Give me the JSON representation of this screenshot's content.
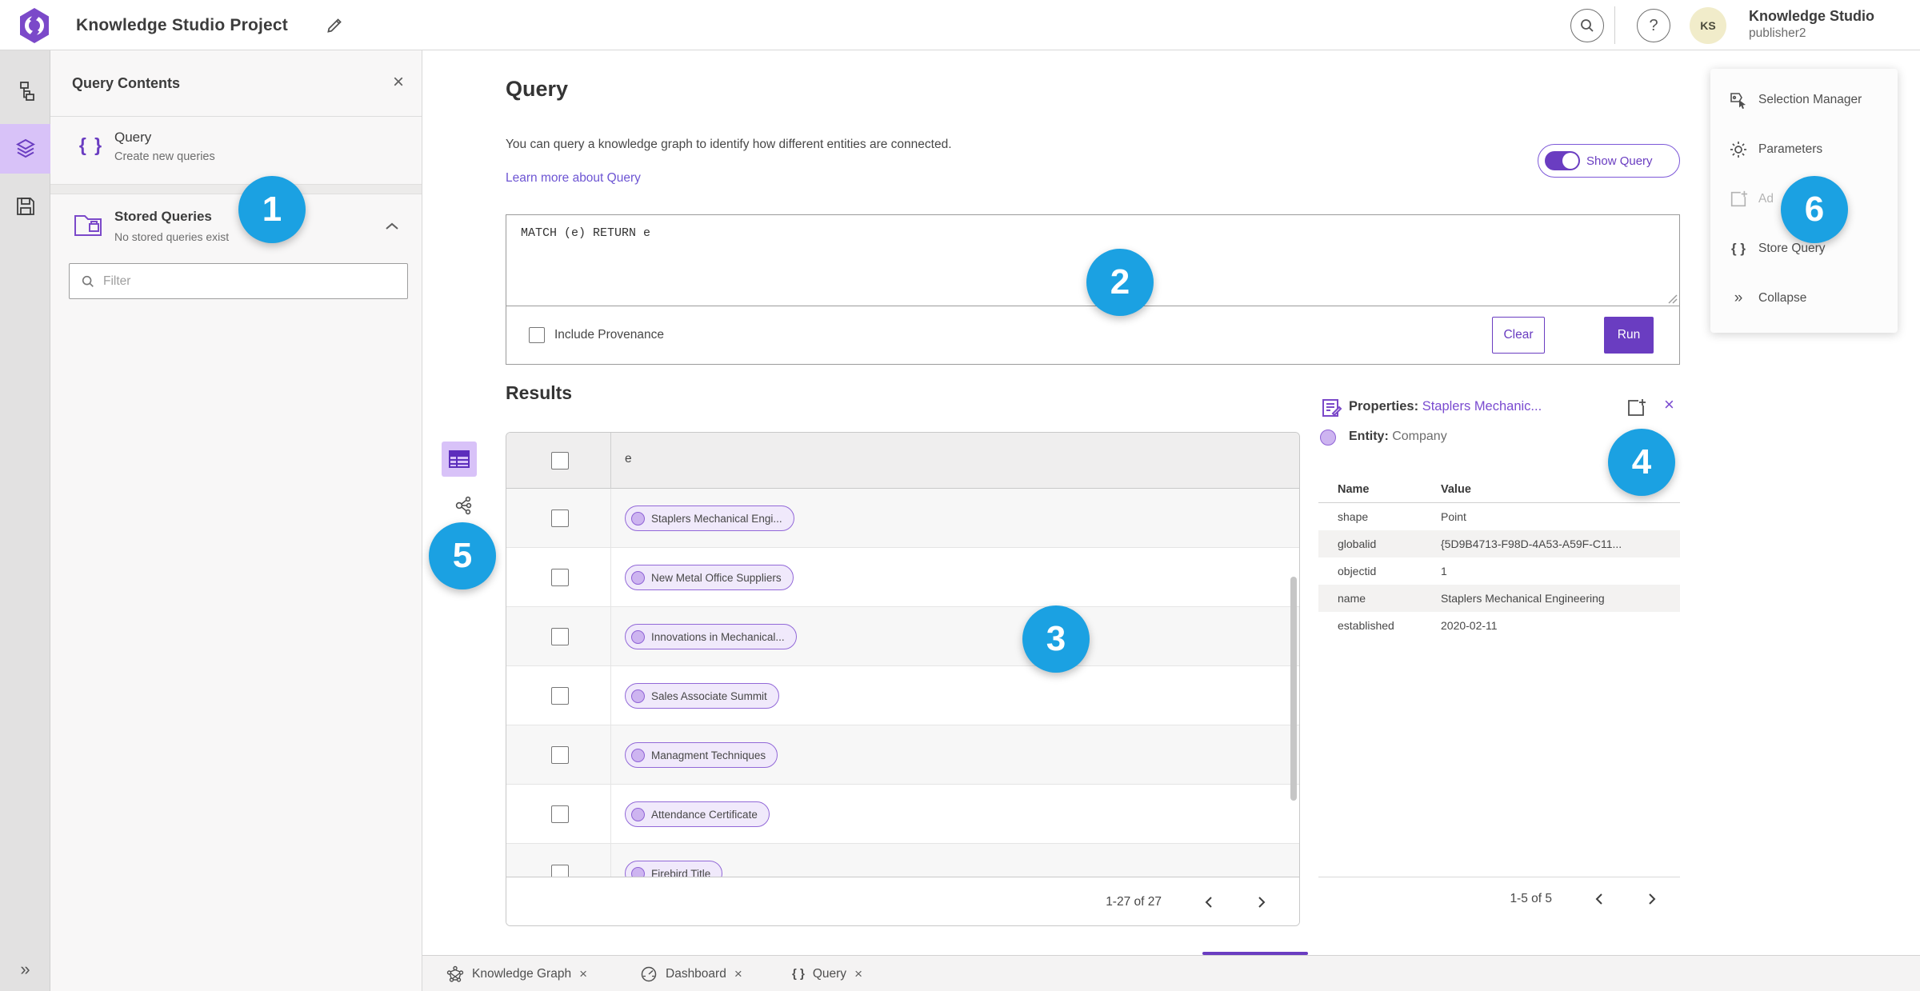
{
  "colors": {
    "accent": "#6a3dc1",
    "badge": "#1ba1e2",
    "chip_bg": "#f0e9fb",
    "chip_border": "#9268d8",
    "link": "#6d55d3"
  },
  "icons": {
    "close": "×",
    "help": "?",
    "braces": "{ }",
    "collapse": "»",
    "expand": "»"
  },
  "topbar": {
    "title": "Knowledge Studio Project",
    "avatar_initials": "KS",
    "account_name": "Knowledge Studio",
    "account_role": "publisher2"
  },
  "contents_panel": {
    "title": "Query Contents",
    "query_item": {
      "label": "Query",
      "desc": "Create new queries"
    },
    "stored_item": {
      "label": "Stored Queries",
      "desc": "No stored queries exist"
    },
    "filter_placeholder": "Filter"
  },
  "query_section": {
    "title": "Query",
    "description": "You can query a knowledge graph to identify how different entities are connected.",
    "link": "Learn more about Query",
    "show_query": "Show Query",
    "query_text": "MATCH (e) RETURN e",
    "include_provenance": "Include Provenance",
    "clear": "Clear",
    "run": "Run"
  },
  "results": {
    "title": "Results",
    "column": "e",
    "rows": [
      "Staplers Mechanical Engi...",
      "New Metal Office Suppliers",
      "Innovations in Mechanical...",
      "Sales Associate Summit",
      "Managment Techniques",
      "Attendance Certificate",
      "Firebird Title"
    ],
    "pagination": "1-27 of 27"
  },
  "properties": {
    "title_prefix": "Properties: ",
    "title_link": "Staplers Mechanic...",
    "entity_prefix": "Entity: ",
    "entity_value": "Company",
    "col_name": "Name",
    "col_value": "Value",
    "rows": [
      {
        "name": "shape",
        "value": "Point"
      },
      {
        "name": "globalid",
        "value": "{5D9B4713-F98D-4A53-A59F-C11..."
      },
      {
        "name": "objectid",
        "value": "1"
      },
      {
        "name": "name",
        "value": "Staplers Mechanical Engineering"
      },
      {
        "name": "established",
        "value": "2020-02-11"
      }
    ],
    "pagination": "1-5 of 5"
  },
  "right_menu": {
    "items": [
      {
        "label": "Selection Manager"
      },
      {
        "label": "Ad"
      },
      {
        "label": "Store Query"
      },
      {
        "label": "Collapse"
      }
    ],
    "parameters_label": "Parameters"
  },
  "tabs": [
    {
      "label": "Knowledge Graph"
    },
    {
      "label": "Dashboard"
    },
    {
      "label": "Query"
    }
  ],
  "badges": [
    "1",
    "2",
    "3",
    "4",
    "5",
    "6"
  ]
}
